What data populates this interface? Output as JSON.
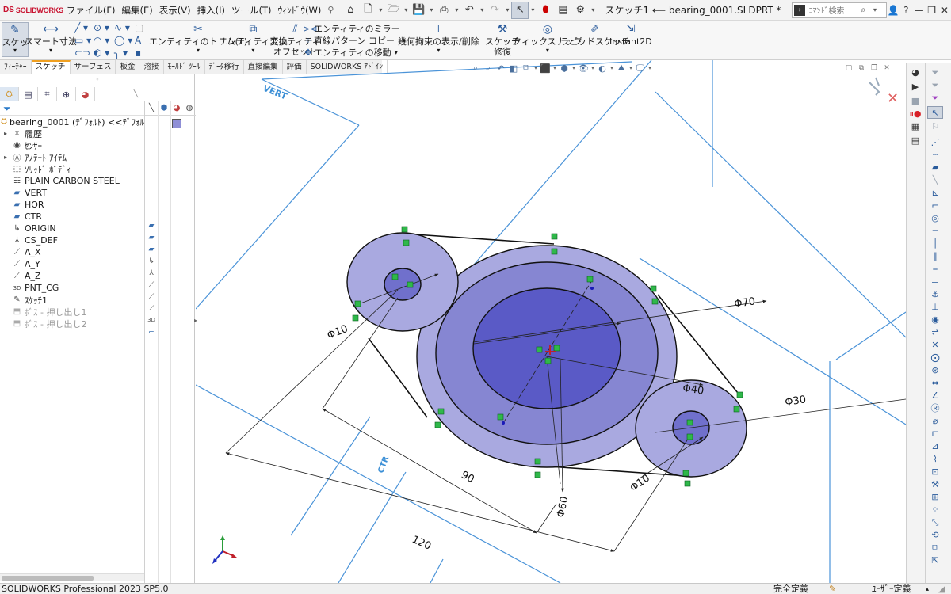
{
  "app": {
    "logo_ds": "DS",
    "logo_name": "SOLIDWORKS"
  },
  "menu": [
    "ファイル(F)",
    "編集(E)",
    "表示(V)",
    "挿入(I)",
    "ツール(T)",
    "ｳｨﾝﾄﾞｳ(W)"
  ],
  "title": "スケッチ1 ⟵ bearing_0001.SLDPRT *",
  "search": {
    "placeholder": "ｺﾏﾝﾄﾞ検索"
  },
  "ribbon": {
    "sketch": "スケッ",
    "smart_dimension": "スマート寸法",
    "trim": "エンティティのトリム(T)",
    "convert": "エンティティ変換",
    "offset_1": "エンティティ",
    "offset_2": "オフセット",
    "mirror": "エンティティのミラー",
    "linear_pattern": "直線パターン コピー",
    "move": "エンティティの移動",
    "relations": "幾何拘束の表示/削除",
    "repair_1": "スケッチ",
    "repair_2": "修復",
    "quick_snap": "クィックスナップ",
    "rapid_sketch": "ラピッドスケッチ",
    "instant2d": "Instant2D"
  },
  "tabs": [
    "ﾌｨｰﾁｬｰ",
    "スケッチ",
    "サーフェス",
    "板金",
    "溶接",
    "ﾓｰﾙﾄﾞ ﾂｰﾙ",
    "ﾃﾞｰﾀ移行",
    "直接編集",
    "評価",
    "SOLIDWORKS ｱﾄﾞｲﾝ"
  ],
  "tree": {
    "root": "bearing_0001 (ﾃﾞﾌｫﾙﾄ) <<ﾃﾞﾌｫﾙ",
    "items": [
      {
        "label": "履歴",
        "icon": "history-icon"
      },
      {
        "label": "ｾﾝｻｰ",
        "icon": "sensor-icon"
      },
      {
        "label": "ｱﾉﾃｰﾄ ｱｲﾃﾑ",
        "icon": "annotation-icon"
      },
      {
        "label": "ｿﾘｯﾄﾞ ﾎﾞﾃﾞｨ",
        "icon": "solid-body-icon"
      },
      {
        "label": "PLAIN CARBON STEEL",
        "icon": "material-icon"
      },
      {
        "label": "VERT",
        "icon": "plane-icon"
      },
      {
        "label": "HOR",
        "icon": "plane-icon"
      },
      {
        "label": "CTR",
        "icon": "plane-icon"
      },
      {
        "label": "ORIGIN",
        "icon": "origin-icon"
      },
      {
        "label": "CS_DEF",
        "icon": "coordinate-system-icon"
      },
      {
        "label": "A_X",
        "icon": "axis-icon"
      },
      {
        "label": "A_Y",
        "icon": "axis-icon"
      },
      {
        "label": "A_Z",
        "icon": "axis-icon"
      },
      {
        "label": "PNT_CG",
        "icon": "point-icon"
      },
      {
        "label": "ｽｹｯﾁ1",
        "icon": "sketch-icon"
      },
      {
        "label": "ﾎﾞｽ - 押し出し1",
        "icon": "extrude-icon"
      },
      {
        "label": "ﾎﾞｽ - 押し出し2",
        "icon": "extrude-icon"
      }
    ]
  },
  "planes": {
    "vert": "VERT",
    "ctr": "CTR"
  },
  "dimensions": {
    "d70": "Φ70",
    "d60": "Φ60",
    "d40": "Φ40",
    "d30": "Φ30",
    "d10_left": "Φ10",
    "d10_right": "Φ10",
    "d90": "90",
    "d120": "120"
  },
  "status": {
    "version": "SOLIDWORKS Professional 2023 SP5.0",
    "state": "完全定義",
    "units": "ﾕｰｻﾞｰ定義"
  },
  "colors": {
    "plane": "#3b8fd6",
    "circle_fill": "#6b6bcc",
    "accent": "#c8102e"
  }
}
